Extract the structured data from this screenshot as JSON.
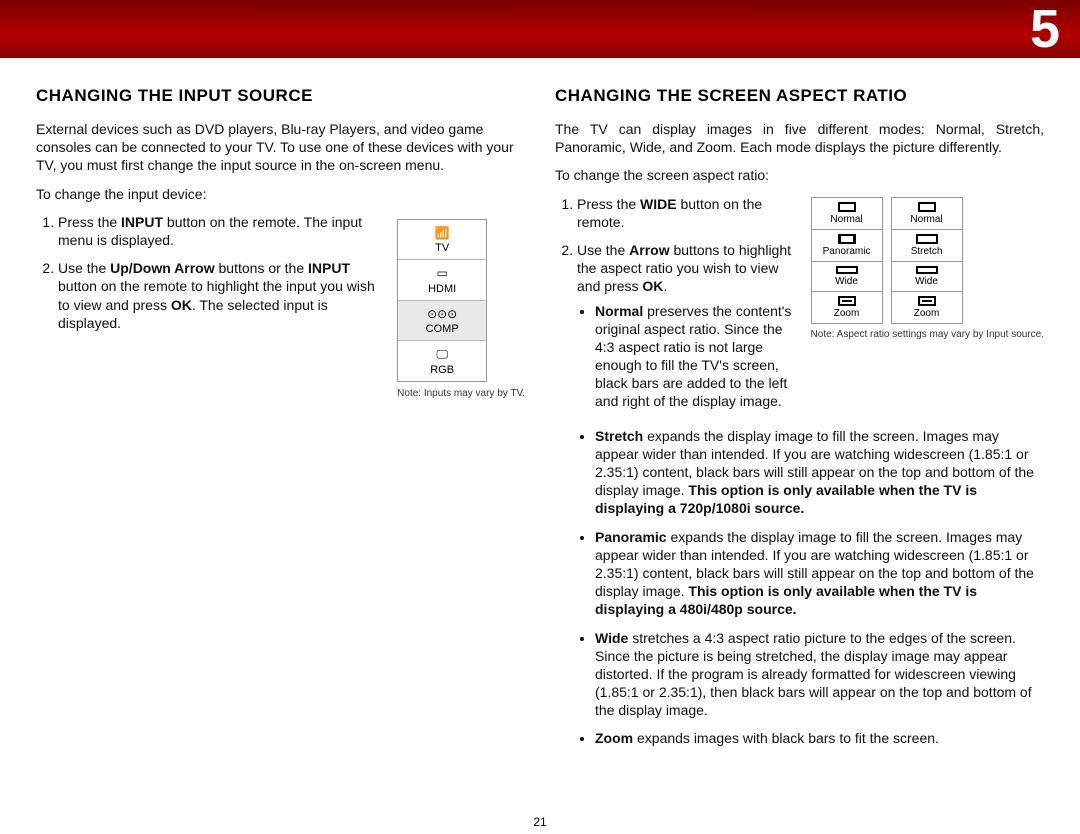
{
  "chapter": "5",
  "page_number": "21",
  "left": {
    "heading": "CHANGING THE INPUT SOURCE",
    "intro": "External devices such as DVD players, Blu-ray Players, and video game consoles can be connected to your TV. To use one of these devices with your TV, you must first change the input source in the on-screen menu.",
    "lead": "To change the input device:",
    "step1_a": "Press the ",
    "step1_bold": "INPUT",
    "step1_b": " button on the remote. The input menu is displayed.",
    "step2_a": "Use the ",
    "step2_bold1": "Up/Down Arrow",
    "step2_b": " buttons or the ",
    "step2_bold2": "INPUT",
    "step2_c": " button on the remote to highlight the input you wish to view and press ",
    "step2_bold3": "OK",
    "step2_d": ". The selected input is displayed.",
    "menu": {
      "icons": [
        "📶",
        "▭",
        "⊙⊙⊙",
        "🖵"
      ],
      "labels": [
        "TV",
        "HDMI",
        "COMP",
        "RGB"
      ],
      "selected_index": 2
    },
    "note": "Note: Inputs may vary by TV."
  },
  "right": {
    "heading": "CHANGING THE SCREEN ASPECT RATIO",
    "intro": "The TV can display images in five different modes: Normal, Stretch, Panoramic, Wide, and Zoom. Each mode displays the picture differently.",
    "lead": "To change the screen aspect ratio:",
    "step1_a": "Press the ",
    "step1_bold": "WIDE",
    "step1_b": " button on the remote.",
    "step2_a": "Use the ",
    "step2_bold1": "Arrow",
    "step2_b": " buttons to highlight the aspect ratio you wish to view and press ",
    "step2_bold2": "OK",
    "step2_c": ".",
    "modes": {
      "normal_bold": "Normal",
      "normal_text": " preserves the content's original aspect ratio. Since the 4:3 aspect ratio is not large enough to fill the TV's screen, black bars are added to the left and right of the display image.",
      "stretch_bold": "Stretch",
      "stretch_text": " expands the display image to fill the screen. Images may appear wider than intended. If you are watching widescreen (1.85:1 or 2.35:1) content, black bars will still appear on the top and bottom of the display image. ",
      "stretch_bold_tail": "This option is only available when the TV is displaying a 720p/1080i source.",
      "pano_bold": "Panoramic",
      "pano_text": " expands the display image to fill the screen. Images may appear wider than intended. If you are watching widescreen (1.85:1 or 2.35:1) content, black bars will still appear on the top and bottom of the display image. ",
      "pano_bold_tail": "This option is only available when the TV is displaying a 480i/480p source.",
      "wide_bold": "Wide",
      "wide_text": " stretches a 4:3 aspect ratio picture to the edges of the screen. Since the picture is being stretched, the display image may appear distorted. If the program is already formatted for widescreen viewing (1.85:1 or 2.35:1), then black bars will appear on the top and bottom of the display image.",
      "zoom_bold": "Zoom",
      "zoom_text": " expands images with black bars to fit the screen."
    },
    "table_a": [
      "Normal",
      "Panoramic",
      "Wide",
      "Zoom"
    ],
    "table_b": [
      "Normal",
      "Stretch",
      "Wide",
      "Zoom"
    ],
    "note": "Note: Aspect ratio settings may vary by Input source."
  }
}
